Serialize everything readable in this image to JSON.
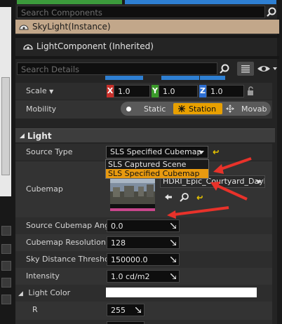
{
  "search_components": {
    "placeholder": "Search Components"
  },
  "components": {
    "instance": "SkyLight(Instance)",
    "inherited": "LightComponent (Inherited)"
  },
  "search_details": {
    "placeholder": "Search Details"
  },
  "scale": {
    "label": "Scale",
    "x_axis": "X",
    "x": "1.0",
    "y_axis": "Y",
    "y": "1.0",
    "z_axis": "Z",
    "z": "1.0"
  },
  "mobility": {
    "label": "Mobility",
    "options": [
      "Static",
      "Station",
      "Movab"
    ],
    "selected": "Station"
  },
  "section_light": "Light",
  "source_type": {
    "label": "Source Type",
    "value": "SLS Specified Cubemap",
    "menu": [
      "SLS Captured Scene",
      "SLS Specified Cubemap"
    ],
    "menu_selected": "SLS Specified Cubemap"
  },
  "cubemap": {
    "label": "Cubemap",
    "asset": "HDRI_Epic_Courtyard_Dayli"
  },
  "properties": [
    {
      "label": "Source Cubemap Angl",
      "value": "0.0"
    },
    {
      "label": "Cubemap Resolution",
      "value": "128"
    },
    {
      "label": "Sky Distance Thresho",
      "value": "150000.0"
    },
    {
      "label": "Intensity",
      "value": "1.0 cd/m2"
    }
  ],
  "light_color": {
    "label": "Light Color",
    "r_label": "R",
    "r_value": "255",
    "swatch": "#ffffff"
  },
  "colors": {
    "accent_orange": "#e8a000",
    "instance_bg": "#c2a78a",
    "arrow_red": "#e8322a"
  }
}
